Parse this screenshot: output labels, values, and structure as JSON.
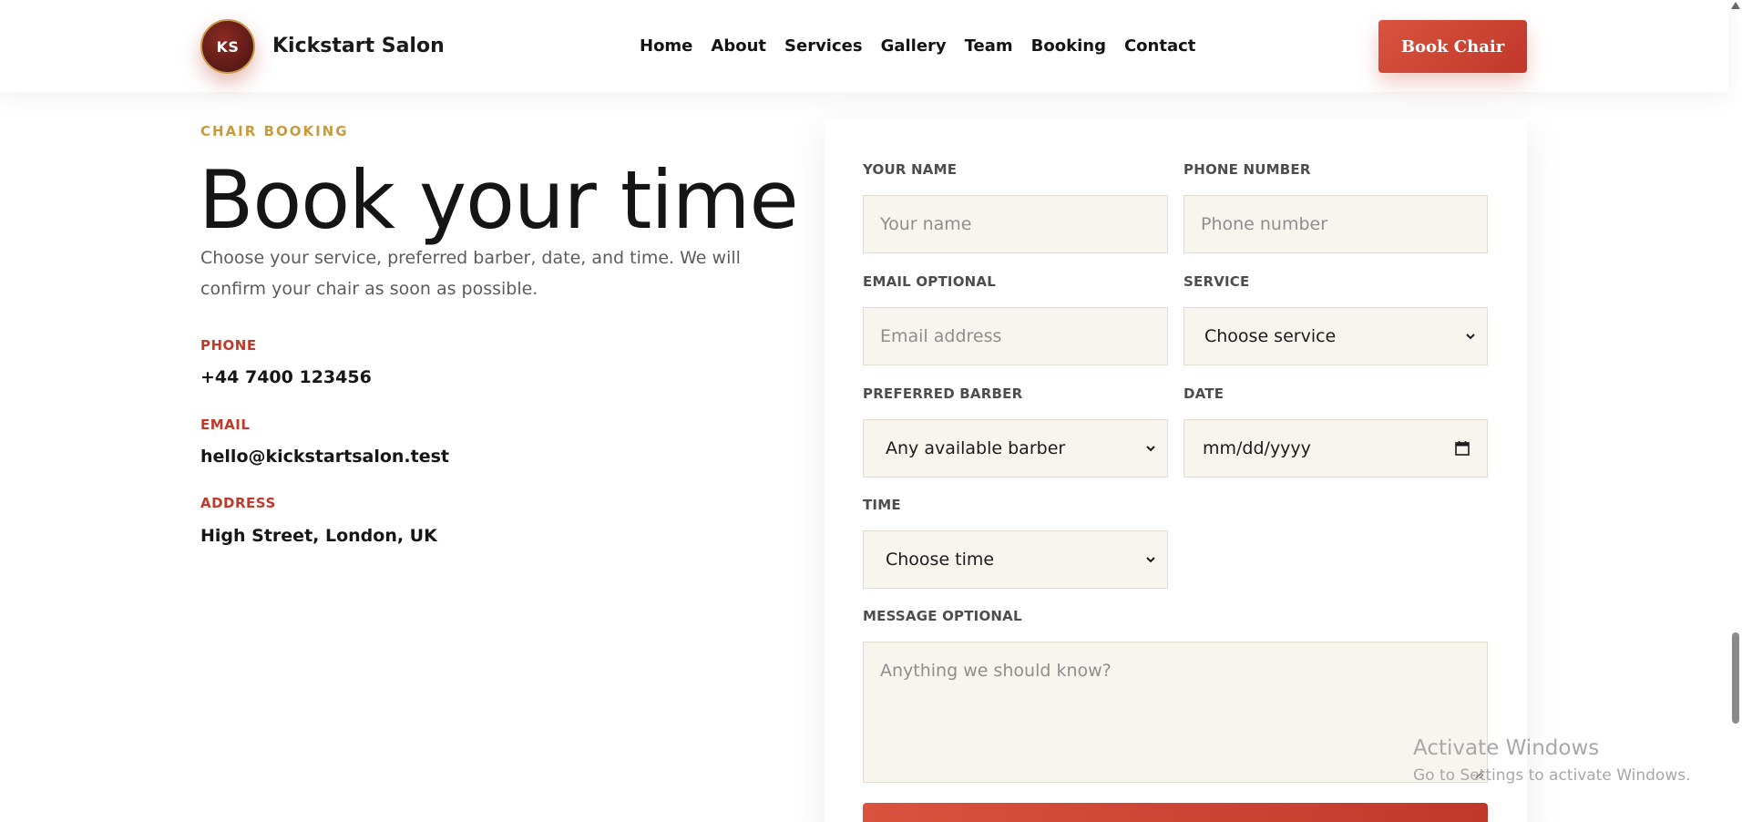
{
  "header": {
    "logo_initials": "KS",
    "brand_name": "Kickstart Salon",
    "nav": [
      "Home",
      "About",
      "Services",
      "Gallery",
      "Team",
      "Booking",
      "Contact"
    ],
    "cta_label": "Book Chair"
  },
  "intro": {
    "eyebrow": "CHAIR BOOKING",
    "title": "Book your time",
    "description": "Choose your service, preferred barber, date, and time. We will confirm your chair as soon as possible."
  },
  "contact": {
    "phone_label": "PHONE",
    "phone": "+44 7400 123456",
    "email_label": "EMAIL",
    "email": "hello@kickstartsalon.test",
    "address_label": "ADDRESS",
    "address": "High Street, London, UK"
  },
  "form": {
    "name_label": "YOUR NAME",
    "name_placeholder": "Your name",
    "phone_label": "PHONE NUMBER",
    "phone_placeholder": "Phone number",
    "email_label": "EMAIL OPTIONAL",
    "email_placeholder": "Email address",
    "service_label": "SERVICE",
    "service_value": "Choose service",
    "barber_label": "PREFERRED BARBER",
    "barber_value": "Any available barber",
    "date_label": "DATE",
    "date_value": "mm/dd/yyyy",
    "time_label": "TIME",
    "time_value": "Choose time",
    "message_label": "MESSAGE OPTIONAL",
    "message_placeholder": "Anything we should know?"
  },
  "watermark": {
    "title": "Activate Windows",
    "subtitle": "Go to Settings to activate Windows."
  },
  "icons": {
    "dropdown": "chevron-down-icon",
    "calendar": "calendar-icon"
  },
  "colors": {
    "accent": "#c0392b",
    "gold": "#c99a3e",
    "field_bg": "#f8f5ef"
  }
}
